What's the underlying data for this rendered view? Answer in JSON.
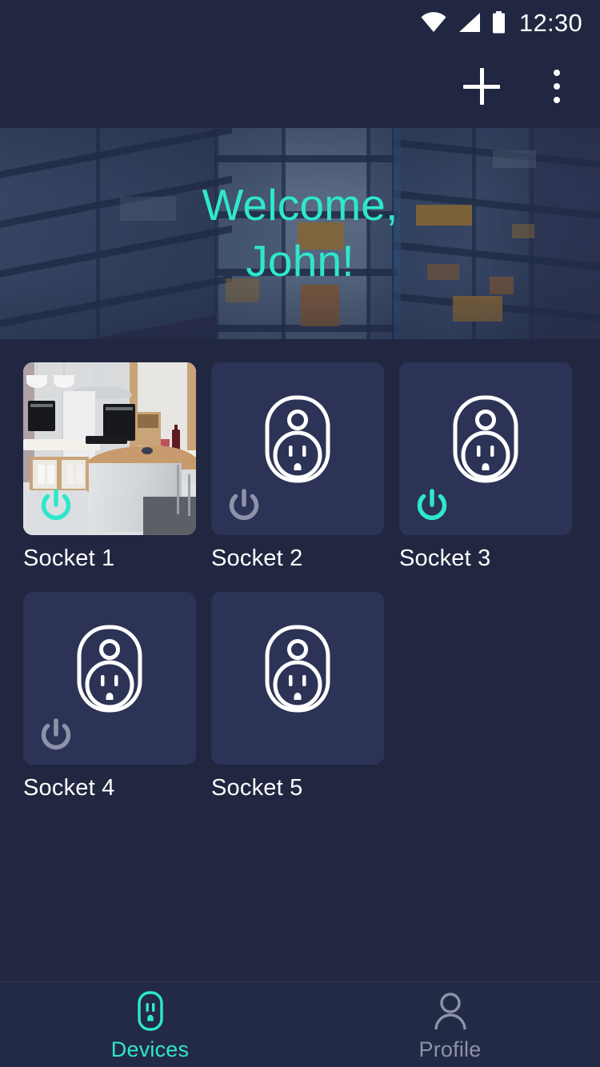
{
  "status_bar": {
    "time": "12:30",
    "icons": [
      "wifi-icon",
      "cellular-signal-icon",
      "battery-icon"
    ]
  },
  "app_bar": {
    "add_label": "+",
    "add_icon": "plus-icon",
    "overflow_icon": "more-vert-icon"
  },
  "hero": {
    "greeting_line1": "Welcome,",
    "greeting_line2": "John!",
    "text_color": "#2ee8cd",
    "background_image": "apartment-building-dusk-photo"
  },
  "theme": {
    "page_background": "#212741",
    "card_background": "#2c3356",
    "accent": "#2ee8cd",
    "text_primary": "#ffffff",
    "text_muted": "#8d93a8",
    "power_off_color": "#8d93a8"
  },
  "devices": [
    {
      "name": "Socket 1",
      "thumbnail": "kitchen-photo",
      "power_state": "on",
      "power_icon": "power-icon"
    },
    {
      "name": "Socket 2",
      "thumbnail": "smart-socket-icon",
      "power_state": "off",
      "power_icon": "power-icon"
    },
    {
      "name": "Socket 3",
      "thumbnail": "smart-socket-icon",
      "power_state": "on",
      "power_icon": "power-icon"
    },
    {
      "name": "Socket 4",
      "thumbnail": "smart-socket-icon",
      "power_state": "off",
      "power_icon": "power-icon"
    },
    {
      "name": "Socket 5",
      "thumbnail": "smart-socket-icon",
      "power_state": "none",
      "power_icon": null
    }
  ],
  "bottom_nav": {
    "items": [
      {
        "label": "Devices",
        "icon": "outlet-icon",
        "active": true
      },
      {
        "label": "Profile",
        "icon": "person-icon",
        "active": false
      }
    ]
  }
}
